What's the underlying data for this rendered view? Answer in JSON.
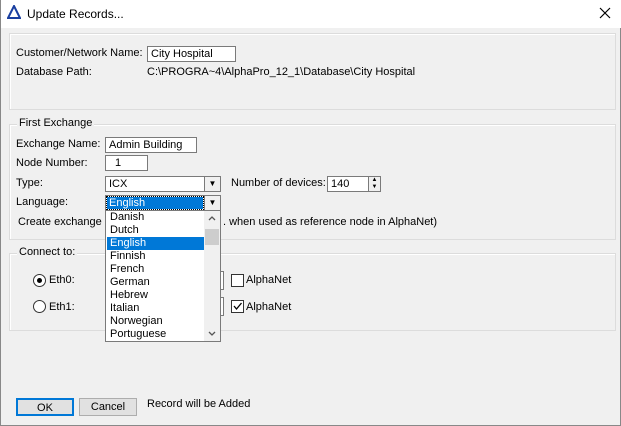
{
  "window": {
    "title": "Update Records...",
    "close_icon": "close-icon",
    "app_icon": "alpha-triangle-icon"
  },
  "customer": {
    "name_label": "Customer/Network Name:",
    "name_value": "City Hospital",
    "path_label": "Database Path:",
    "path_value": "C:\\PROGRA~4\\AlphaPro_12_1\\Database\\City Hospital"
  },
  "exchange": {
    "legend": "First Exchange",
    "name_label": "Exchange Name:",
    "name_value": "Admin Building",
    "node_label": "Node Number:",
    "node_value": "1",
    "type_label": "Type:",
    "type_value": "ICX",
    "devices_label": "Number of devices:",
    "devices_value": "140",
    "language_label": "Language:",
    "language_value": "English",
    "create_text_start": "Create exchange c",
    "create_text_end": ". when used as reference node in AlphaNet)",
    "language_options": [
      "Danish",
      "Dutch",
      "English",
      "Finnish",
      "French",
      "German",
      "Hebrew",
      "Italian",
      "Norwegian",
      "Portuguese"
    ],
    "selected_index": 2
  },
  "connect": {
    "legend": "Connect to:",
    "eth0_label": "Eth0:",
    "eth0_selected": true,
    "eth0_alphanet": false,
    "eth1_label": "Eth1:",
    "eth1_selected": false,
    "eth1_alphanet": true,
    "alphanet_label": "AlphaNet"
  },
  "footer": {
    "ok": "OK",
    "cancel": "Cancel",
    "status": "Record will be Added"
  }
}
